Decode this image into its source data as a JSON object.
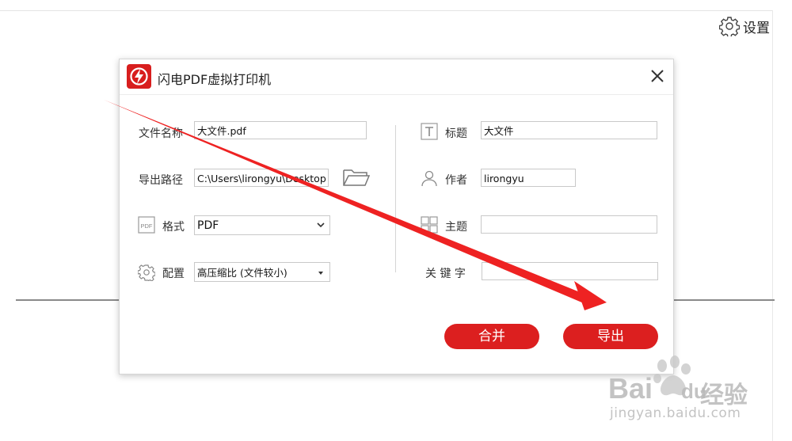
{
  "app": {
    "settings_label": "设置"
  },
  "dialog": {
    "title": "闪电PDF虚拟打印机",
    "left": {
      "filename_label": "文件名称",
      "filename_value": "大文件.pdf",
      "path_label": "导出路径",
      "path_value": "C:\\Users\\lirongyu\\Desktop",
      "format_label": "格式",
      "format_value": "PDF",
      "config_label": "配置",
      "config_value": "高压缩比 (文件较小)"
    },
    "right": {
      "title_label": "标题",
      "title_value": "大文件",
      "author_label": "作者",
      "author_value": "lirongyu",
      "subject_label": "主题",
      "subject_value": "",
      "keywords_label": "关 键 字",
      "keywords_value": ""
    },
    "buttons": {
      "merge": "合并",
      "export": "导出"
    }
  },
  "annotation": {
    "arrow_color": "#ee2222"
  },
  "watermark": {
    "brand": "Bai",
    "brand_suffix": "du",
    "product": "经验",
    "url": "jingyan.baidu.com"
  },
  "colors": {
    "accent": "#dc1f1f"
  }
}
